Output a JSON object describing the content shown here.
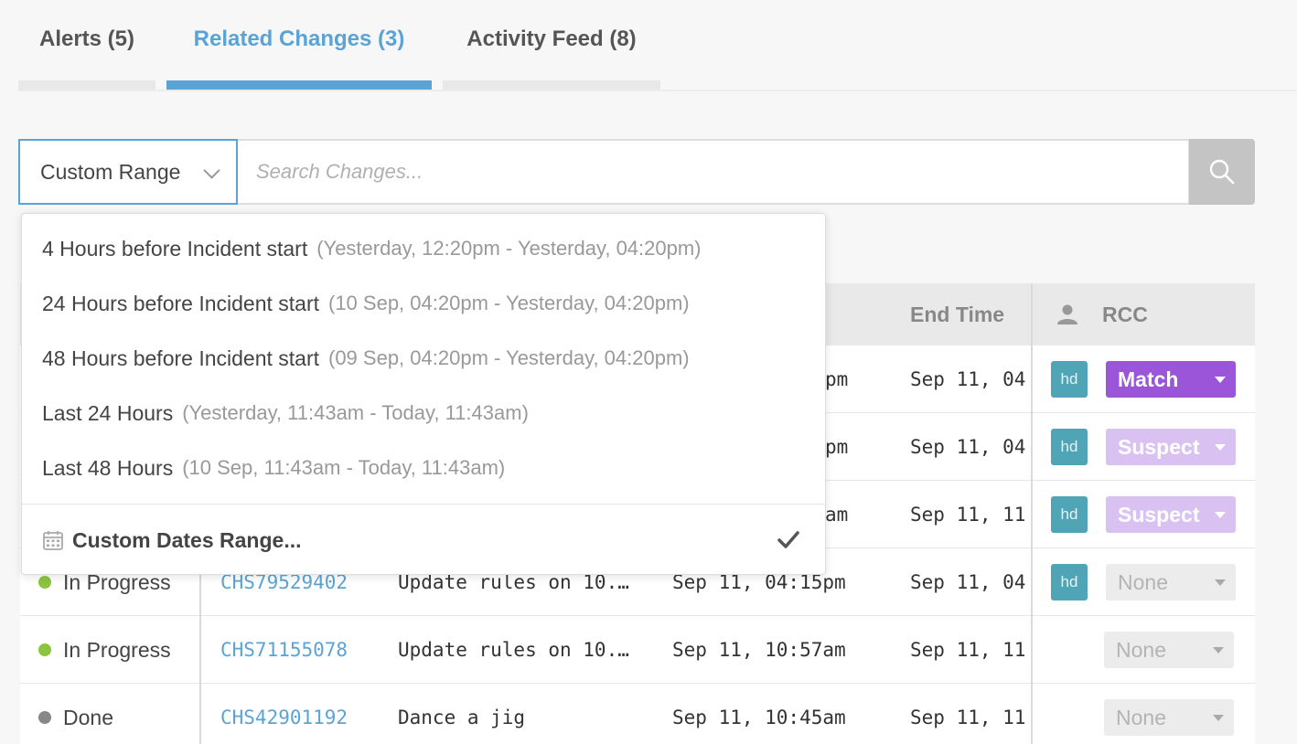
{
  "tabs": [
    {
      "label": "Alerts (5)"
    },
    {
      "label": "Related Changes (3)"
    },
    {
      "label": "Activity Feed (8)"
    }
  ],
  "filter": {
    "range_label": "Custom Range",
    "search_placeholder": "Search Changes..."
  },
  "dropdown": {
    "items": [
      {
        "label": "4 Hours before Incident start",
        "range": "(Yesterday, 12:20pm - Yesterday, 04:20pm)"
      },
      {
        "label": "24 Hours before Incident start",
        "range": "(10 Sep, 04:20pm - Yesterday, 04:20pm)"
      },
      {
        "label": "48 Hours before Incident start",
        "range": "(09 Sep, 04:20pm - Yesterday, 04:20pm)"
      },
      {
        "label": "Last 24 Hours",
        "range": "(Yesterday, 11:43am - Today, 11:43am)"
      },
      {
        "label": "Last 48 Hours",
        "range": "(10 Sep, 11:43am - Today, 11:43am)"
      }
    ],
    "custom_label": "Custom Dates Range..."
  },
  "table": {
    "headers": {
      "end_time": "End Time",
      "rcc": "RCC"
    },
    "rows": [
      {
        "status": "",
        "change_id": "",
        "description": "",
        "start": "pm",
        "end": "Sep 11, 04",
        "avatar": "hd",
        "rcc": "Match"
      },
      {
        "status": "",
        "change_id": "",
        "description": "",
        "start": "pm",
        "end": "Sep 11, 04",
        "avatar": "hd",
        "rcc": "Suspect"
      },
      {
        "status": "",
        "change_id": "",
        "description": "",
        "start": "am",
        "end": "Sep 11, 11",
        "avatar": "hd",
        "rcc": "Suspect"
      },
      {
        "status": "In Progress",
        "change_id": "CHS79529402",
        "description": "Update rules on 10.…",
        "start": "Sep 11, 04:15pm",
        "end": "Sep 11, 04",
        "avatar": "hd",
        "rcc": "None"
      },
      {
        "status": "In Progress",
        "change_id": "CHS71155078",
        "description": "Update rules on 10.…",
        "start": "Sep 11, 10:57am",
        "end": "Sep 11, 11",
        "avatar": "",
        "rcc": "None"
      },
      {
        "status": "Done",
        "change_id": "CHS42901192",
        "description": "Dance a jig",
        "start": "Sep 11, 10:45am",
        "end": "Sep 11, 11",
        "avatar": "",
        "rcc": "None"
      }
    ]
  },
  "colors": {
    "accent": "#5ba3d5",
    "in_progress": "#8cc43f",
    "done": "#888888",
    "match": "#9a55d8",
    "suspect": "#d9c2f1"
  }
}
